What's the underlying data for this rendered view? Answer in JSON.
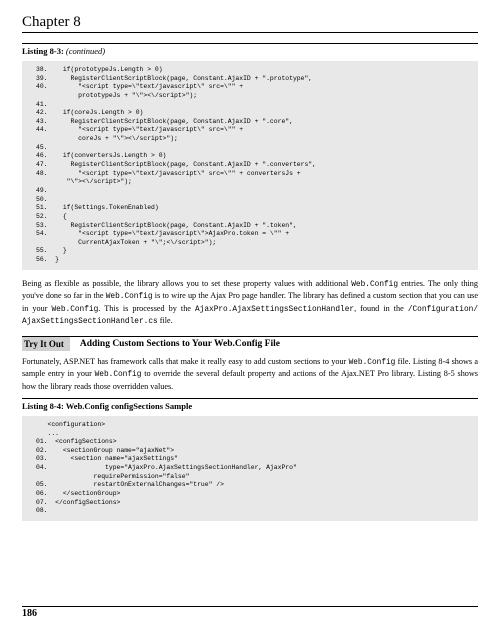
{
  "chapter": "Chapter 8",
  "listing1": {
    "title": "Listing 8-3:",
    "continued": "(continued)",
    "code": "38.    if(prototypeJs.Length > 0)\n39.      RegisterClientScriptBlock(page, Constant.AjaxID + \".prototype\",\n40.        \"<script type=\\\"text/javascript\\\" src=\\\"\" +\n           prototypeJs + \"\\\"><\\/script>\");\n41.\n42.    if(coreJs.Length > 0)\n43.      RegisterClientScriptBlock(page, Constant.AjaxID + \".core\",\n44.        \"<script type=\\\"text/javascript\\\" src=\\\"\" +\n           coreJs + \"\\\"><\\/script>\");\n45.\n46.    if(convertersJs.Length > 0)\n47.      RegisterClientScriptBlock(page, Constant.AjaxID + \".converters\",\n48.        \"<script type=\\\"text/javascript\\\" src=\\\"\" + convertersJs +\n        \"\\\"><\\/script>\");\n49.\n50.\n51.    if(Settings.TokenEnabled)\n52.    {\n53.      RegisterClientScriptBlock(page, Constant.AjaxID + \".token\",\n54.        \"<script type=\\\"text/javascript\\\">AjaxPro.token = \\\"\" +\n           CurrentAjaxToken + \"\\\";<\\/script>\");\n55.    }\n56.  }"
  },
  "para1_a": "Being as flexible as possible, the library allows you to set these property values with additional ",
  "para1_b": "Web.Config",
  "para1_c": " entries. The only thing you've done so far in the ",
  "para1_d": "Web.Config",
  "para1_e": " is to wire up the Ajax Pro page handler. The library has defined a custom section that you can use in your ",
  "para1_f": "Web.Config",
  "para1_g": ". This is processed by the ",
  "para1_h": "AjaxPro.AjaxSettingsSectionHandler",
  "para1_i": ", found in the ",
  "para1_j": "/Configuration/ AjaxSettingsSectionHandler.cs",
  "para1_k": " file.",
  "tryit": {
    "label": "Try It Out",
    "title": "Adding Custom Sections to Your Web.Config File"
  },
  "para2_a": "Fortunately, ASP.NET has framework calls that make it really easy to add custom sections to your ",
  "para2_b": "Web.Config",
  "para2_c": " file. Listing 8-4 shows a sample entry in your ",
  "para2_d": "Web.Config",
  "para2_e": " to override the several default property and actions of the Ajax.NET Pro library. Listing 8-5 shows how the library reads those overridden values.",
  "listing2": {
    "title": "Listing 8-4: Web.Config configSections Sample",
    "code": "   <configuration>\n   ...\n01.  <configSections>\n02.    <sectionGroup name=\"ajaxNet\">\n03.      <section name=\"ajaxSettings\"\n04.               type=\"AjaxPro.AjaxSettingsSectionHandler, AjaxPro\"\n               requirePermission=\"false\"\n05.            restartOnExternalChanges=\"true\" />\n06.    </sectionGroup>\n07.  </configSections>\n08."
  },
  "page_number": "186"
}
